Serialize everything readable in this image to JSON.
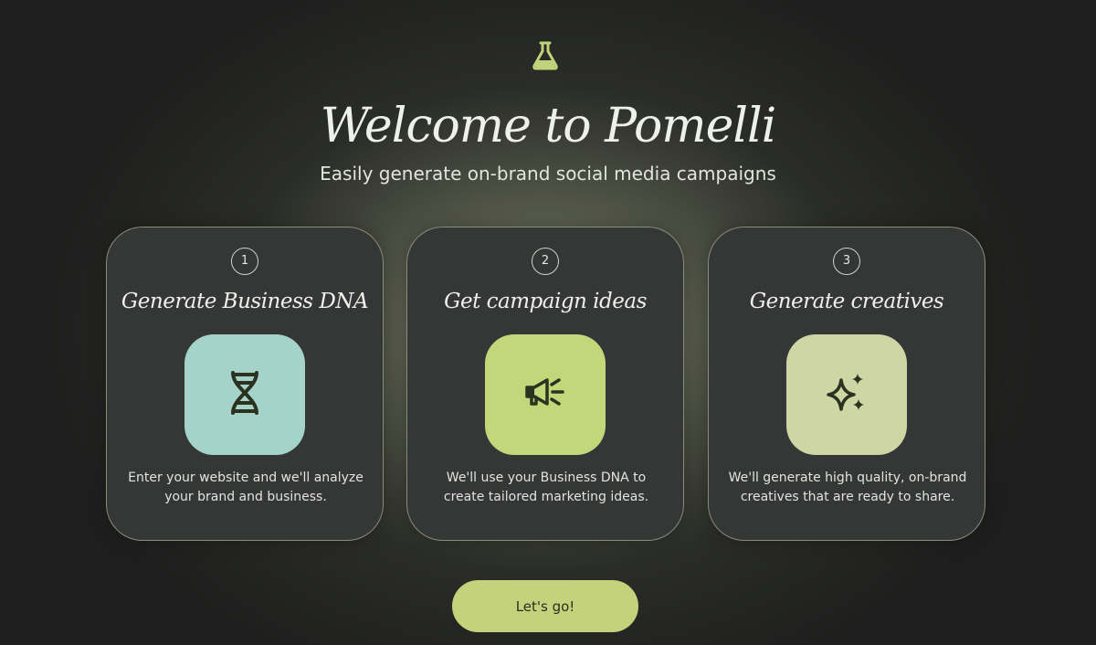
{
  "header": {
    "logo_icon": "flask-icon",
    "title": "Welcome to Pomelli",
    "subtitle": "Easily generate on-brand social media campaigns"
  },
  "steps": [
    {
      "number": "1",
      "title": "Generate Business DNA",
      "icon": "dna-icon",
      "tile_color": "#a5d3c9",
      "description": "Enter your website and we'll analyze your brand and business."
    },
    {
      "number": "2",
      "title": "Get campaign ideas",
      "icon": "megaphone-icon",
      "tile_color": "#c2d67a",
      "description": "We'll use your Business DNA to create tailored marketing ideas."
    },
    {
      "number": "3",
      "title": "Generate creatives",
      "icon": "sparkles-icon",
      "tile_color": "#cfd6a5",
      "description": "We'll generate high quality, on-brand creatives that are ready to share."
    }
  ],
  "cta": {
    "label": "Let's go!"
  },
  "colors": {
    "background": "#1d1e1d",
    "card": "#353636",
    "accent": "#c5d27c",
    "icon_dark": "#2b3320"
  }
}
